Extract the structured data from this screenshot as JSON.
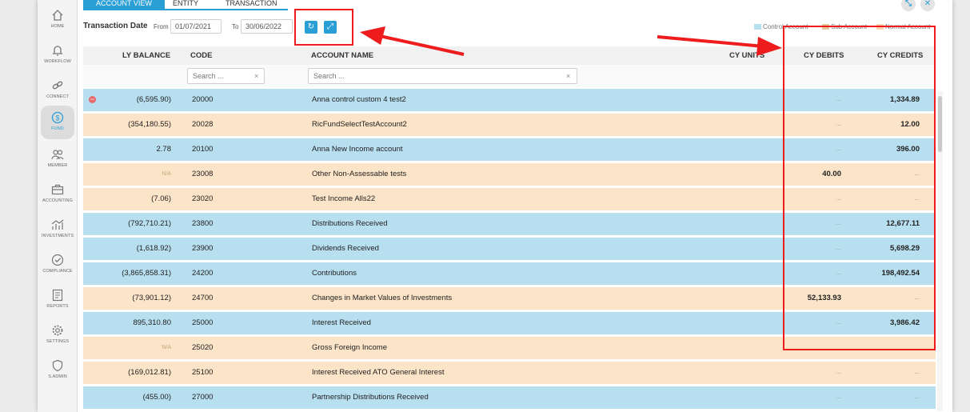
{
  "sidebar": {
    "items": [
      {
        "label": "HOME",
        "icon": "home-icon"
      },
      {
        "label": "WORKFLOW",
        "icon": "bell-icon"
      },
      {
        "label": "CONNECT",
        "icon": "link-icon"
      },
      {
        "label": "FUND",
        "icon": "dollar-icon"
      },
      {
        "label": "MEMBER",
        "icon": "users-icon"
      },
      {
        "label": "ACCOUNTING",
        "icon": "briefcase-icon"
      },
      {
        "label": "INVESTMENTS",
        "icon": "chart-icon"
      },
      {
        "label": "COMPLIANCE",
        "icon": "check-circle-icon"
      },
      {
        "label": "REPORTS",
        "icon": "report-icon"
      },
      {
        "label": "SETTINGS",
        "icon": "gear-icon"
      },
      {
        "label": "S.ADMIN",
        "icon": "shield-icon"
      }
    ]
  },
  "tabs": [
    {
      "label": "ACCOUNT VIEW",
      "active": true
    },
    {
      "label": "ENTITY",
      "active": false
    },
    {
      "label": "TRANSACTION",
      "active": false
    }
  ],
  "filter": {
    "title": "Transaction Date",
    "from_label": "From",
    "from_value": "01/07/2021",
    "to_label": "To",
    "to_value": "30/06/2022"
  },
  "legend": [
    {
      "label": "Control Account",
      "color": "#b8dff0"
    },
    {
      "label": "Sub Account",
      "color": "#e0c79c"
    },
    {
      "label": "Normal Account",
      "color": "#fbd6b0"
    }
  ],
  "columns": {
    "ly_balance": "LY BALANCE",
    "code": "CODE",
    "account_name": "ACCOUNT NAME",
    "cy_units": "CY UNITS",
    "cy_debits": "CY DEBITS",
    "cy_credits": "CY CREDITS"
  },
  "search": {
    "placeholder": "Search ...",
    "clear": "×"
  },
  "placeholder_dots": "...",
  "rows": [
    {
      "ly_balance": "(6,595.90)",
      "code": "20000",
      "name": "Anna control custom 4 test2",
      "cy_debits": "...",
      "cy_credits": "1,334.89",
      "type": "control",
      "expanded": true
    },
    {
      "ly_balance": "(354,180.55)",
      "code": "20028",
      "name": "RicFundSelectTestAccount2",
      "cy_debits": "...",
      "cy_credits": "12.00",
      "type": "normal"
    },
    {
      "ly_balance": "2.78",
      "code": "20100",
      "name": "Anna New Income account",
      "cy_debits": "...",
      "cy_credits": "396.00",
      "type": "control"
    },
    {
      "ly_balance": "N/A",
      "code": "23008",
      "name": "Other Non-Assessable tests",
      "cy_debits": "40.00",
      "cy_credits": "...",
      "type": "normal"
    },
    {
      "ly_balance": "(7.06)",
      "code": "23020",
      "name": "Test Income Alls22",
      "cy_debits": "...",
      "cy_credits": "...",
      "type": "normal"
    },
    {
      "ly_balance": "(792,710.21)",
      "code": "23800",
      "name": "Distributions Received",
      "cy_debits": "...",
      "cy_credits": "12,677.11",
      "type": "control"
    },
    {
      "ly_balance": "(1,618.92)",
      "code": "23900",
      "name": "Dividends Received",
      "cy_debits": "...",
      "cy_credits": "5,698.29",
      "type": "control"
    },
    {
      "ly_balance": "(3,865,858.31)",
      "code": "24200",
      "name": "Contributions",
      "cy_debits": "...",
      "cy_credits": "198,492.54",
      "type": "control"
    },
    {
      "ly_balance": "(73,901.12)",
      "code": "24700",
      "name": "Changes in Market Values of Investments",
      "cy_debits": "52,133.93",
      "cy_credits": "...",
      "type": "normal"
    },
    {
      "ly_balance": "895,310.80",
      "code": "25000",
      "name": "Interest Received",
      "cy_debits": "...",
      "cy_credits": "3,986.42",
      "type": "control"
    },
    {
      "ly_balance": "N/A",
      "code": "25020",
      "name": "Gross Foreign Income",
      "cy_debits": "",
      "cy_credits": "",
      "type": "normal"
    },
    {
      "ly_balance": "(169,012.81)",
      "code": "25100",
      "name": "Interest Received ATO General Interest",
      "cy_debits": "...",
      "cy_credits": "...",
      "type": "normal"
    },
    {
      "ly_balance": "(455.00)",
      "code": "27000",
      "name": "Partnership Distributions Received",
      "cy_debits": "...",
      "cy_credits": "...",
      "type": "control"
    }
  ],
  "colors": {
    "accent": "#2a9fd6",
    "control_row": "#b8dff0",
    "normal_row": "#fbe4c8",
    "annotation": "#ee1c1c"
  }
}
